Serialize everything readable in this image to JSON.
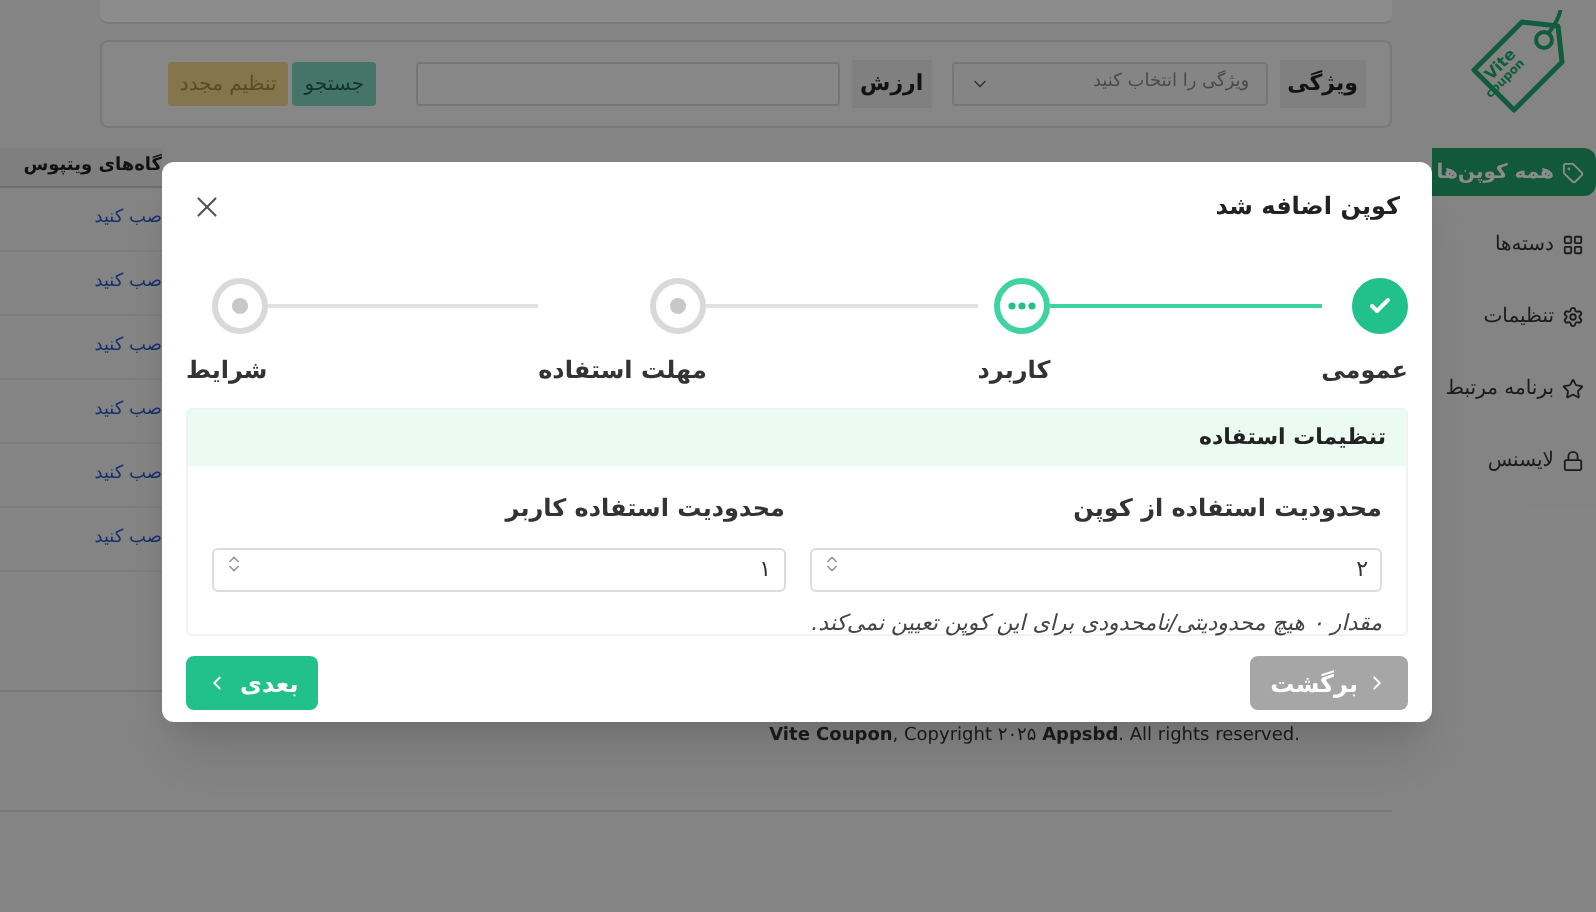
{
  "logo": {
    "line1": "Vite",
    "line2": "coupon"
  },
  "sidebar": {
    "items": [
      {
        "label": "همه کوپن‌ها",
        "selected": true
      },
      {
        "label": "دسته‌ها",
        "selected": false
      },
      {
        "label": "تنظیمات",
        "selected": false
      },
      {
        "label": "برنامه مرتبط",
        "selected": false
      },
      {
        "label": "لایسنس",
        "selected": false
      }
    ]
  },
  "filter": {
    "attribute_label": "ویژگی",
    "attribute_placeholder": "ویژگی را انتخاب کنید",
    "value_label": "ارزش",
    "search_button": "جستجو",
    "reset_button": "تنظیم مجدد"
  },
  "table": {
    "column_1": "گاه‌های ویتپوس",
    "rows": [
      "صب کنید",
      "صب کنید",
      "صب کنید",
      "صب کنید",
      "صب کنید",
      "صب کنید"
    ]
  },
  "footer": "**Vite Coupon**, Copyright ۲۰۲۵ **Appsbd**. All rights reserved.",
  "dialog": {
    "title": "کوپن اضافه شد",
    "steps": [
      {
        "label": "عمومی",
        "kind": "done"
      },
      {
        "label": "کاربرد",
        "kind": "current"
      },
      {
        "label": "مهلت استفاده",
        "kind": "pending"
      },
      {
        "label": "شرایط",
        "kind": "pending"
      }
    ],
    "section_title": "تنظیمات استفاده",
    "fields": [
      {
        "label": "محدودیت استفاده از کوپن",
        "value": "۲",
        "help": "مقدار ۰ هیچ محدودیتی/نامحدودی برای این کوپن تعیین نمی‌کند."
      },
      {
        "label": "محدودیت استفاده کاربر",
        "value": "۱"
      }
    ],
    "back_button": {
      "label": "برگشت",
      "disabled": true
    },
    "next_button": {
      "label": "بعدی",
      "disabled": false
    }
  }
}
